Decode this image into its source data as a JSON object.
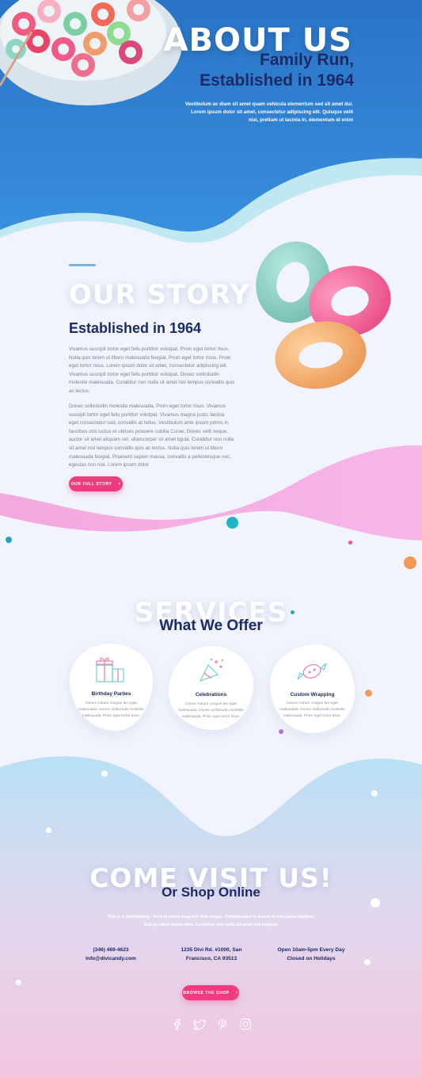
{
  "hero": {
    "title": "ABOUT US",
    "subtitle_line1": "Family Run,",
    "subtitle_line2": "Established in 1964",
    "paragraph": "Vestibulum ac diam sit amet quam vehicula elementum sed sit amet dui. Lorem ipsum dolor sit amet, consectetur adipiscing elit. Quisque velit nisi, pretium ut lacinia in, elementum id enim"
  },
  "story": {
    "title": "OUR STORY",
    "subtitle": "Established in 1964",
    "para1": "Vivamus suscipit tortor eget felis porttitor volutpat. Proin eget tortor risus. Nulla quis lorem ut libero malesuada feugiat. Proin eget tortor risus. Proin eget tortor risus. Lorem ipsum dolor sit amet, consectetur adipiscing elit. Vivamus suscipit tortor eget felis porttitor volutpat. Donec sollicitudin molestie malesuada. Curabitur non nulla sit amet nisl tempus convallis quis ac lectus.",
    "para2": "Donec sollicitudin molestie malesuada. Proin eget tortor risus. Vivamus suscipit tortor eget felis porttitor volutpat. Vivamus magna justo, lacinia eget consectetur sed, convallis at tellus. Vestibulum ante ipsum primis in faucibus orci luctus et ultrices posuere cubilia Curae; Donec velit neque, auctor sit amet aliquam vel, ullamcorper sit amet ligula. Curabitur non nulla sit amet nisl tempus convallis quis ac lectus. Nulla quis lorem ut libero malesuada feugiat. Praesent sapien massa, convallis a pellentesque nec, egestas non nisi. Lorem ipsum dolor",
    "button": "OUR FULL STORY"
  },
  "services": {
    "title": "SERVICES",
    "subtitle": "What We Offer",
    "cards": [
      {
        "title": "Birthday Parties",
        "text": "Donec rutrum congue leo eget malesuada. Donec sollicitudin molestie malesuada. Proin eget tortor risus.",
        "icon": "gift-icon"
      },
      {
        "title": "Celebrations",
        "text": "Donec rutrum congue leo eget malesuada. Donec sollicitudin molestie malesuada. Proin eget tortor risus.",
        "icon": "party-popper-icon"
      },
      {
        "title": "Custom Wrapping",
        "text": "Donec rutrum congue leo eget malesuada. Donec sollicitudin molestie malesuada. Proin eget tortor risus.",
        "icon": "candy-icon"
      }
    ]
  },
  "visit": {
    "title": "COME VISIT US!",
    "subtitle": "Or Shop Online",
    "paragraph": "This is a subheading - Here is some long text that wraps - Pellentesque in ipsum id orci porta dapibus. Sed porttitor lectus nibh. Curabitur non nulla sit amet nisl tempus.",
    "phone": "(346) 469-4623",
    "email": "info@divicandy.com",
    "address_line1": "1235 Divi Rd. #1000, San",
    "address_line2": "Francisco, CA 93513",
    "hours_line1": "Open 10am-5pm Every Day",
    "hours_line2": "Closed on Holidays",
    "button": "BROWSE THE SHOP",
    "social": [
      "facebook-icon",
      "twitter-icon",
      "pinterest-icon",
      "instagram-icon"
    ]
  },
  "colors": {
    "hero_blue": "#2d7fd0",
    "navy": "#1d2a66",
    "pink": "#f23a7e",
    "background": "#f1f4fc"
  }
}
